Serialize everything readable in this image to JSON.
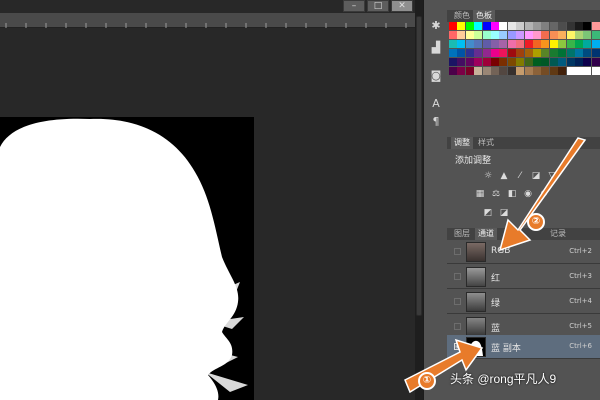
{
  "window": {
    "minimize": "–",
    "maximize": "□",
    "close": "✕"
  },
  "strip_icons": [
    "arrows-icon",
    "histogram-icon",
    "adjust-icon",
    "text-icon",
    "paragraph-icon"
  ],
  "color_panel": {
    "tabs": [
      "颜色",
      "色板"
    ],
    "active": "色板"
  },
  "adjust_panel": {
    "tabs": [
      "调整",
      "样式"
    ],
    "active": "调整",
    "title": "添加调整"
  },
  "channel_panel": {
    "tabs": [
      "图层",
      "通道",
      "路径",
      "历史记录"
    ],
    "visible_tab_labels": [
      "图层",
      "通道",
      "路",
      "记录"
    ],
    "active": "通道",
    "rows": [
      {
        "name": "RGB",
        "shortcut": "Ctrl+2"
      },
      {
        "name": "红",
        "shortcut": "Ctrl+3"
      },
      {
        "name": "绿",
        "shortcut": "Ctrl+4"
      },
      {
        "name": "蓝",
        "shortcut": "Ctrl+5"
      },
      {
        "name": "蓝 副本",
        "shortcut": "Ctrl+6",
        "selected": true
      }
    ]
  },
  "callouts": [
    {
      "label": "①"
    },
    {
      "label": "②"
    }
  ],
  "watermark": "头条 @rong平凡人9",
  "accent_color": "#e87b2a"
}
